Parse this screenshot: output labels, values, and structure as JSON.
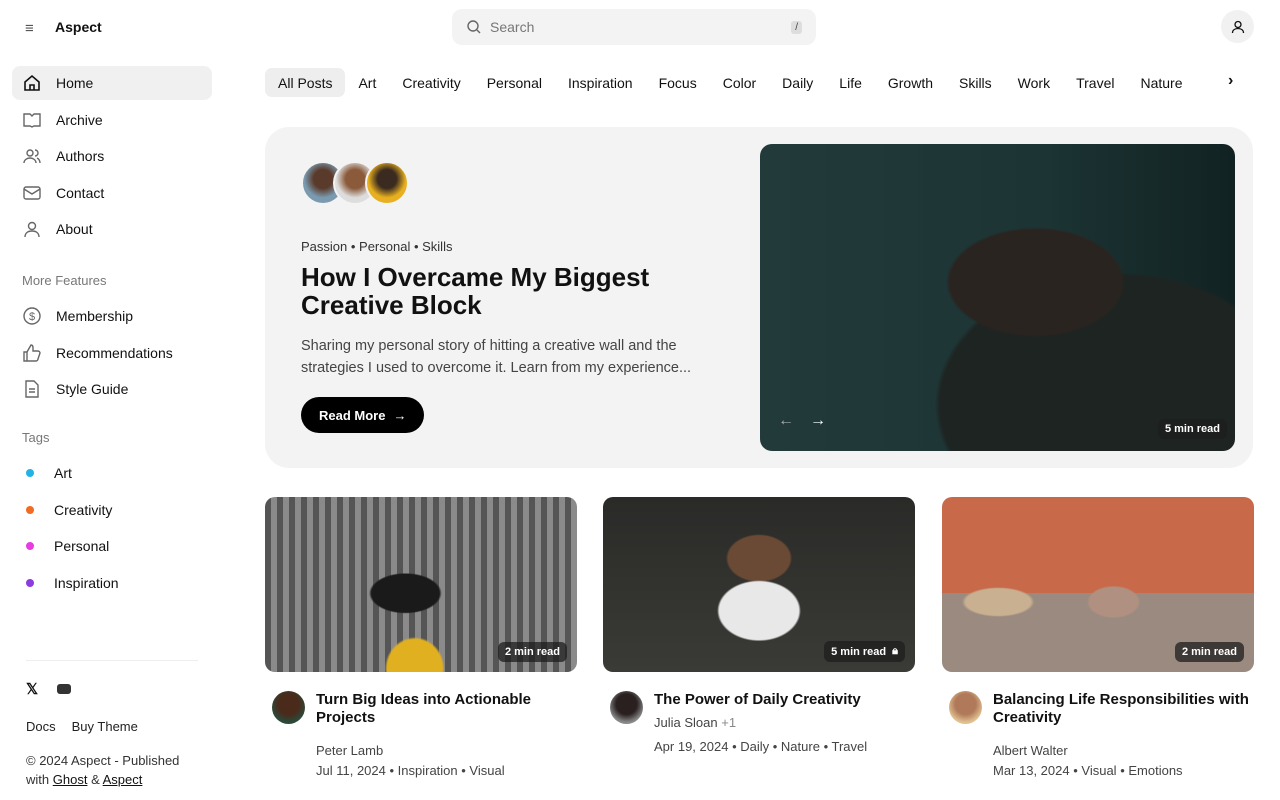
{
  "header": {
    "brand": "Aspect",
    "search_placeholder": "Search",
    "search_shortcut": "/"
  },
  "sidebar": {
    "nav": [
      {
        "label": "Home",
        "icon": "home-icon"
      },
      {
        "label": "Archive",
        "icon": "book-icon"
      },
      {
        "label": "Authors",
        "icon": "users-icon"
      },
      {
        "label": "Contact",
        "icon": "mail-icon"
      },
      {
        "label": "About",
        "icon": "user-icon"
      }
    ],
    "more_title": "More Features",
    "more": [
      {
        "label": "Membership",
        "icon": "dollar-icon"
      },
      {
        "label": "Recommendations",
        "icon": "thumbs-up-icon"
      },
      {
        "label": "Style Guide",
        "icon": "document-icon"
      }
    ],
    "tags_title": "Tags",
    "tags": [
      {
        "label": "Art",
        "color": "#22b3e6"
      },
      {
        "label": "Creativity",
        "color": "#f26b21"
      },
      {
        "label": "Personal",
        "color": "#e63ce0"
      },
      {
        "label": "Inspiration",
        "color": "#8b3be0"
      }
    ],
    "footer_links": [
      "Docs",
      "Buy Theme"
    ],
    "copyright": "© 2024 Aspect - Published with",
    "ghost": "Ghost",
    "amp": "&",
    "aspect": "Aspect"
  },
  "tabs": [
    "All Posts",
    "Art",
    "Creativity",
    "Personal",
    "Inspiration",
    "Focus",
    "Color",
    "Daily",
    "Life",
    "Growth",
    "Skills",
    "Work",
    "Travel",
    "Nature"
  ],
  "hero": {
    "tags": [
      "Passion",
      "Personal",
      "Skills"
    ],
    "title": "How I Overcame My Biggest Creative Block",
    "excerpt": "Sharing my personal story of hitting a creative wall and the strategies I used to overcome it. Learn from my experience...",
    "button": "Read More",
    "read_time": "5 min read"
  },
  "cards": [
    {
      "title": "Turn Big Ideas into Actionable Projects",
      "author": "Peter Lamb",
      "extra": "",
      "date": "Jul 11, 2024",
      "tags": [
        "Inspiration",
        "Visual"
      ],
      "read_time": "2 min read",
      "locked": false
    },
    {
      "title": "The Power of Daily Creativity",
      "author": "Julia Sloan",
      "extra": "+1",
      "date": "Apr 19, 2024",
      "tags": [
        "Daily",
        "Nature",
        "Travel"
      ],
      "read_time": "5 min read",
      "locked": true
    },
    {
      "title": "Balancing Life Responsibilities with Creativity",
      "author": "Albert Walter",
      "extra": "",
      "date": "Mar 13, 2024",
      "tags": [
        "Visual",
        "Emotions"
      ],
      "read_time": "2 min read",
      "locked": false
    }
  ]
}
